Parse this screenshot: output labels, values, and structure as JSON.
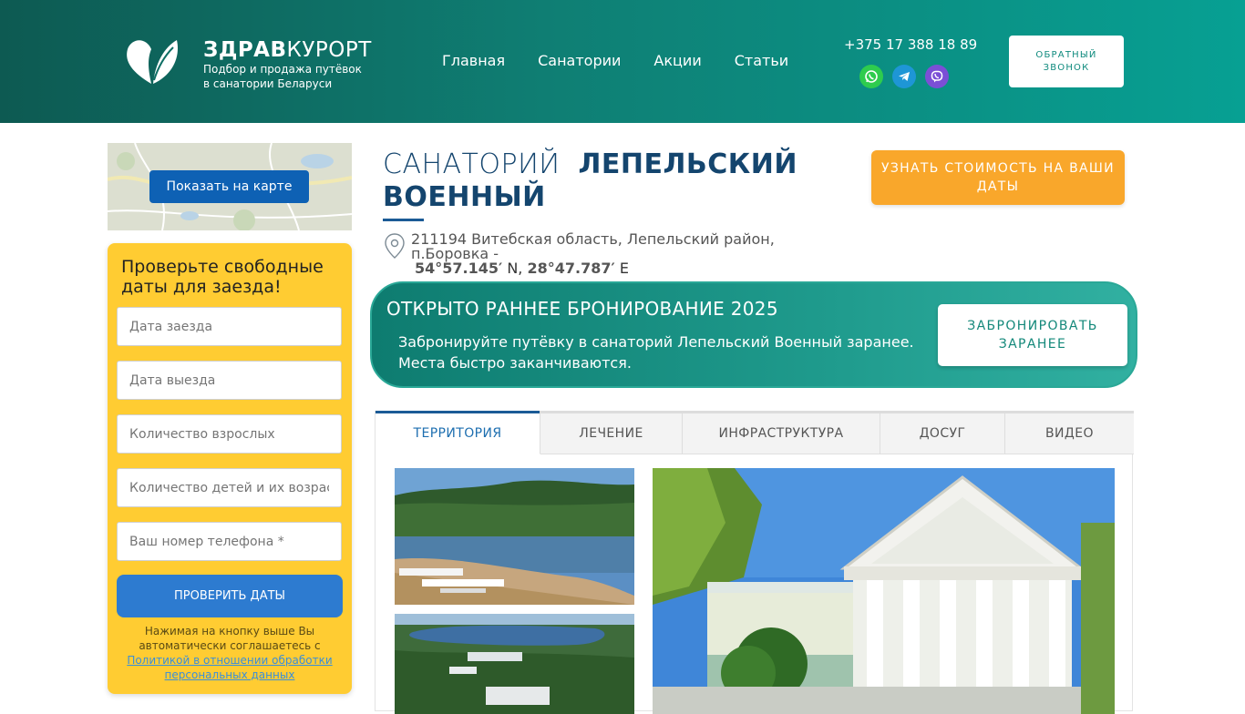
{
  "header": {
    "brand_bold": "ЗДРАВ",
    "brand_light": "КУРОРТ",
    "brand_sub": "Подбор и продажа путёвок в санатории Беларуси",
    "nav": [
      "Главная",
      "Санатории",
      "Акции",
      "Статьи"
    ],
    "phone": "+375 17 388 18 89",
    "callback_label": "ОБРАТНЫЙ ЗВОНОК"
  },
  "sidebar": {
    "map_button": "Показать на карте",
    "form": {
      "title": "Проверьте свободные даты для заезда!",
      "fields": [
        "Дата заезда",
        "Дата выезда",
        "Количество взрослых",
        "Количество детей и их возраст",
        "Ваш номер телефона *"
      ],
      "submit": "ПРОВЕРИТЬ ДАТЫ",
      "note_text": "Нажимая на кнопку выше Вы автоматически соглашаетесь с",
      "note_link": "Политикой в отношении обработки персональных данных"
    }
  },
  "main": {
    "title_light": "САНАТОРИЙ",
    "title_bold": "ЛЕПЕЛЬСКИЙ ВОЕННЫЙ",
    "address": "211194 Витебская область, Лепельский район, п.Боровка -",
    "coord_lat": "54°57.145′",
    "coord_lat_dir": "N,",
    "coord_lon": "28°47.787′",
    "coord_lon_dir": "E",
    "cost_button": "УЗНАТЬ СТОИМОСТЬ НА ВАШИ ДАТЫ",
    "banner": {
      "title": "ОТКРЫТО РАННЕЕ БРОНИРОВАНИЕ 2025",
      "text": "Забронируйте путёвку в санаторий Лепельский Военный заранее. Места быстро заканчиваются.",
      "button": "ЗАБРОНИРОВАТЬ ЗАРАНЕЕ"
    },
    "tabs": [
      "ТЕРРИТОРИЯ",
      "ЛЕЧЕНИЕ",
      "ИНФРАСТРУКТУРА",
      "ДОСУГ",
      "ВИДЕО"
    ]
  },
  "colors": {
    "header_start": "#0d5a52",
    "header_end": "#07a093",
    "accent_orange": "#f9a72b",
    "form_yellow": "#ffcc32",
    "title_blue": "#14456e",
    "map_button": "#0e61b4"
  }
}
